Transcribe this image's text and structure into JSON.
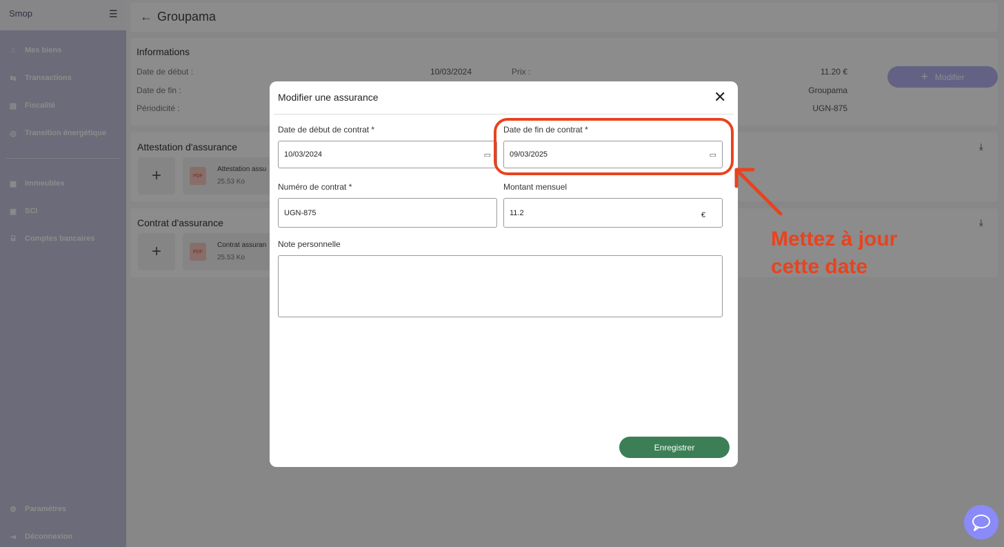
{
  "sidebar": {
    "logo": "Smop",
    "items": [
      {
        "label": "Mes biens",
        "icon": "home-icon"
      },
      {
        "label": "Transactions",
        "icon": "transfer-icon"
      },
      {
        "label": "Fiscalité",
        "icon": "document-icon"
      },
      {
        "label": "Transition énergétique",
        "icon": "energy-icon"
      },
      {
        "label": "Immeubles",
        "icon": "building-icon"
      },
      {
        "label": "SCI",
        "icon": "briefcase-icon"
      },
      {
        "label": "Comptes bancaires",
        "icon": "bank-icon"
      }
    ],
    "bottom": [
      {
        "label": "Paramètres",
        "icon": "gear-icon"
      },
      {
        "label": "Déconnexion",
        "icon": "logout-icon"
      }
    ]
  },
  "header": {
    "title": "Groupama"
  },
  "info": {
    "heading": "Informations",
    "rows": [
      {
        "label": "Date de début :",
        "value": "10/03/2024"
      },
      {
        "label": "Date de fin :",
        "value": ""
      },
      {
        "label": "Périodicité :",
        "value": ""
      }
    ],
    "right_rows": [
      {
        "label": "Prix :",
        "value": "11.20 €"
      },
      {
        "label": "",
        "value": "Groupama"
      },
      {
        "label": "",
        "value": "UGN-875"
      }
    ],
    "modify_label": "Modifier"
  },
  "attestation": {
    "heading": "Attestation d'assurance",
    "file_name": "Attestation assu",
    "file_size": "25.53 Ko"
  },
  "contrat": {
    "heading": "Contrat d'assurance",
    "file_name": "Contrat assuran",
    "file_size": "25.53 Ko"
  },
  "modal": {
    "title": "Modifier une assurance",
    "start_label": "Date de début de contrat *",
    "start_value": "10/03/2024",
    "end_label": "Date de fin de contrat *",
    "end_value": "09/03/2025",
    "number_label": "Numéro de contrat *",
    "number_value": "UGN-875",
    "amount_label": "Montant mensuel",
    "amount_value": "11.2",
    "currency": "€",
    "note_label": "Note personnelle",
    "save_label": "Enregistrer"
  },
  "annotation": {
    "line1": "Mettez à jour",
    "line2": "cette date",
    "color": "#e8431f"
  }
}
